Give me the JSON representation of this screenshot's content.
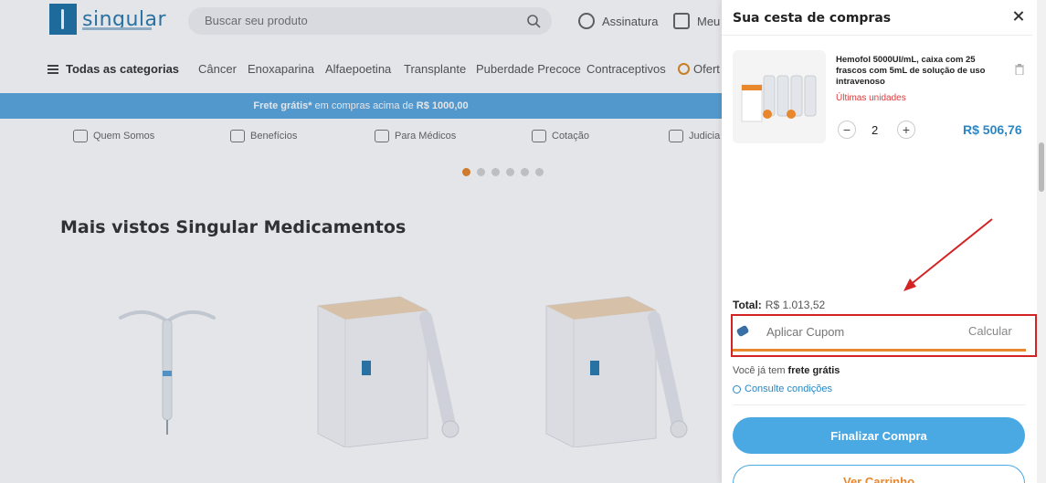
{
  "header": {
    "logo_text": "singular",
    "search_placeholder": "Buscar seu produto",
    "subscription_label": "Assinatura",
    "my_label": "Meu"
  },
  "categories": {
    "all_label": "Todas as categorias",
    "items": [
      "Câncer",
      "Enoxaparina",
      "Alfaepoetina",
      "Transplante",
      "Puberdade Precoce",
      "Contraceptivos",
      "Ofert"
    ]
  },
  "banner": {
    "prefix": "Frete grátis*",
    "middle": "em compras acima de",
    "amount": "R$ 1000,00"
  },
  "benefits": [
    "Quem Somos",
    "Benefícios",
    "Para Médicos",
    "Cotação",
    "Judicia"
  ],
  "carousel": {
    "dots": 6,
    "active": 0
  },
  "section": {
    "title": "Mais vistos Singular Medicamentos"
  },
  "cart": {
    "title": "Sua cesta de compras",
    "item": {
      "name": "Hemofol 5000UI/mL, caixa com 25 frascos com 5mL de solução de uso intravenoso",
      "stock": "Últimas unidades",
      "qty": "2",
      "minus": "−",
      "plus": "+",
      "price": "R$ 506,76"
    },
    "total_label": "Total:",
    "total_value": "R$ 1.013,52",
    "coupon_placeholder": "Aplicar Cupom",
    "coupon_button": "Calcular",
    "free_ship_prefix": "Você já tem",
    "free_ship_bold": "frete grátis",
    "conditions_link": "Consulte condições",
    "checkout_button": "Finalizar Compra",
    "view_cart_button": "Ver Carrinho"
  },
  "colors": {
    "accent_blue": "#4aa8e3",
    "orange": "#e8872c",
    "highlight_red": "#d32323"
  }
}
